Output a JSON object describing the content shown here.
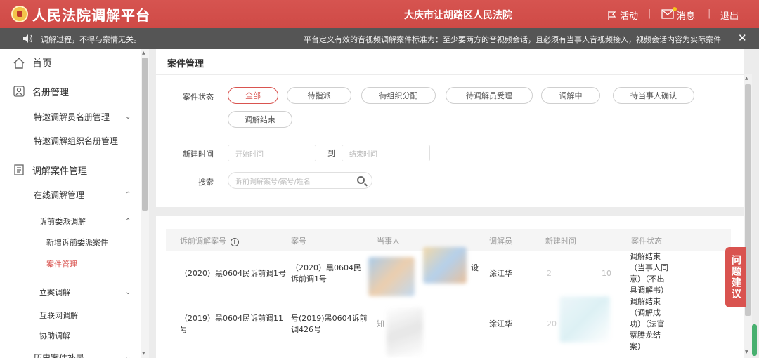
{
  "header": {
    "app_title": "人民法院调解平台",
    "court_name": "大庆市让胡路区人民法院",
    "activity_label": "活动",
    "messages_label": "消息",
    "logout_label": "退出",
    "separator": "|",
    "color": "#d9534f"
  },
  "notice": {
    "text_left": "调解过程，不得与案情无关。",
    "text_right": "平台定义有效的音视频调解案件标准为：至少要两方的音视频会话，且必须有当事人音视频接入，视频会话内容为实际案件"
  },
  "sidebar": {
    "home": "首页",
    "roster": "名册管理",
    "mediator_roster": "特邀调解员名册管理",
    "org_roster": "特邀调解组织名册管理",
    "case_mgmt": "调解案件管理",
    "online_mgmt": "在线调解管理",
    "pre_litigation": "诉前委派调解",
    "new_case": "新增诉前委派案件",
    "case_manage": "案件管理",
    "filing": "立案调解",
    "internet": "互联网调解",
    "assist": "协助调解",
    "history": "历史案件补录"
  },
  "main": {
    "title": "案件管理",
    "status_label": "案件状态",
    "statuses": [
      "全部",
      "待指派",
      "待组织分配",
      "待调解员受理",
      "调解中",
      "待当事人确认",
      "调解结束"
    ],
    "time_label": "新建时间",
    "start_placeholder": "开始时间",
    "to_label": "到",
    "end_placeholder": "结束时间",
    "search_label": "搜索",
    "search_placeholder": "诉前调解案号/案号/姓名"
  },
  "table": {
    "headers": [
      "诉前调解案号",
      "案号",
      "当事人",
      "调解员",
      "新建时间",
      "案件状态"
    ],
    "rows": [
      {
        "pre_no": "（2020）黑0604民诉前调1号",
        "case_no_1": "（2020）黑0604民",
        "case_no_2": "诉前调1号",
        "party_suffix": "设",
        "mediator": "涂江华",
        "time_frag_a": "2",
        "time_frag_b": "10",
        "status": [
          "调解结束",
          "（当事人同",
          "意）（不出",
          "具调解书）"
        ]
      },
      {
        "pre_no_1": "（2019）黑0604民诉前调11",
        "pre_no_2": "号",
        "case_no_1": "号(2019)黑0604诉前",
        "case_no_2": "调426号",
        "party_prefix": "知",
        "mediator": "涂江华",
        "time_frag_a": "20",
        "status": [
          "调解结束",
          "（调解成",
          "功）（法官",
          "蔡腾龙结",
          "案）"
        ]
      }
    ]
  },
  "feedback_label": "问题建议"
}
